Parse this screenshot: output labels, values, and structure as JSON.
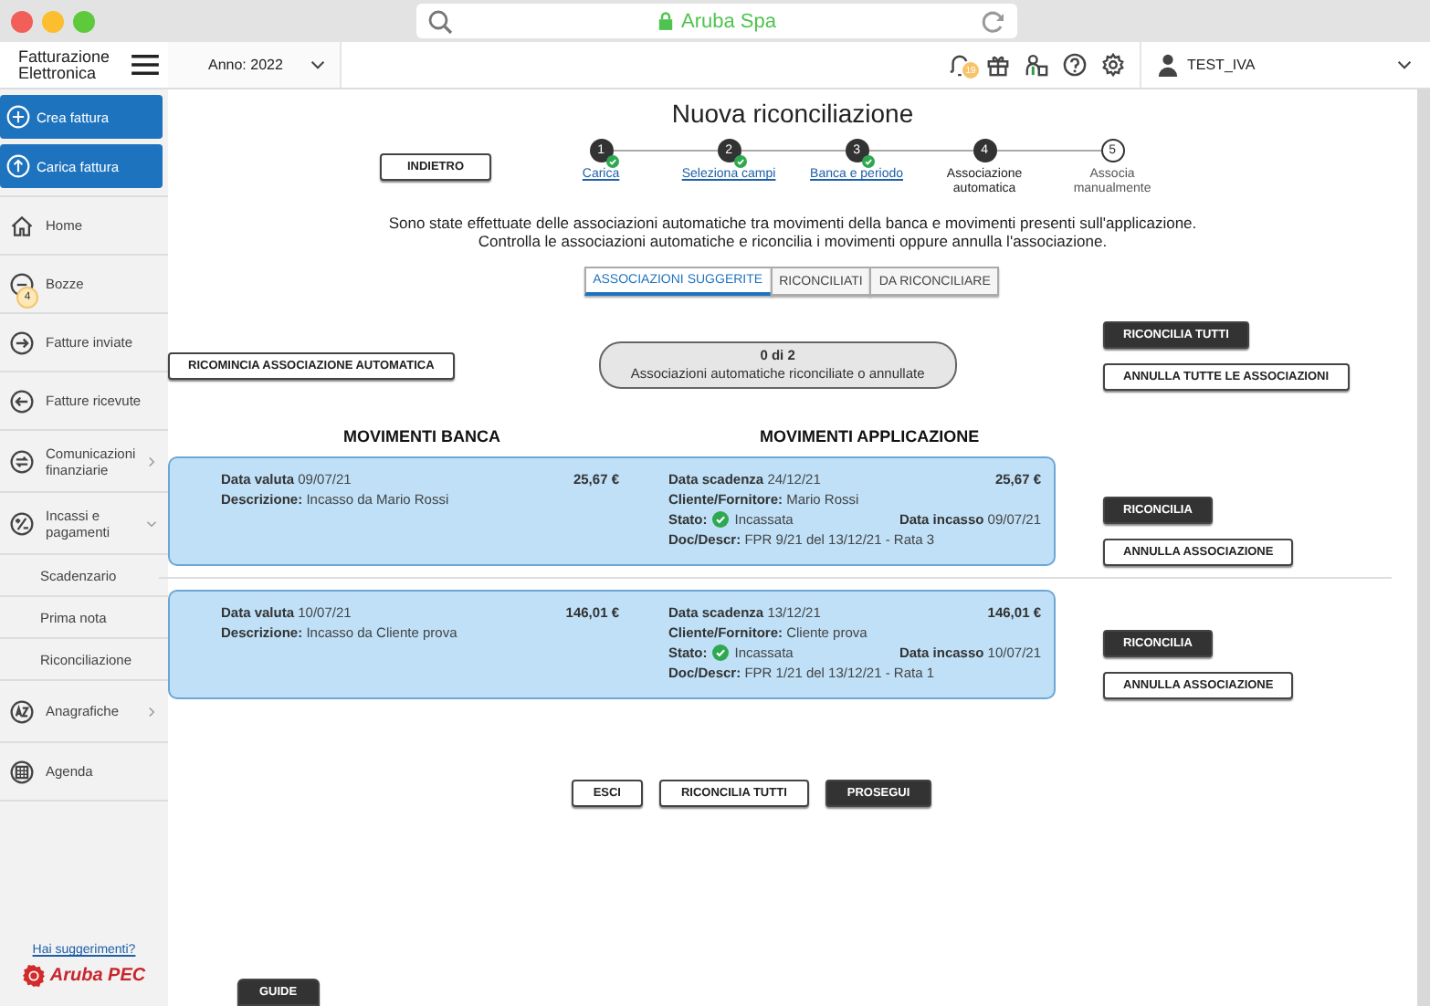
{
  "browser": {
    "address": "Aruba Spa"
  },
  "header": {
    "app_name": "Fatturazione Elettronica",
    "year": "Anno: 2022",
    "notification_count": "19",
    "user": "TEST_IVA"
  },
  "sidebar": {
    "actions": [
      "Crea fattura",
      "Carica fattura"
    ],
    "items": [
      {
        "label": "Home",
        "kind": "link"
      },
      {
        "label": "Bozze",
        "kind": "link",
        "badge": "4"
      },
      {
        "label": "Fatture inviate",
        "kind": "link"
      },
      {
        "label": "Fatture ricevute",
        "kind": "link"
      },
      {
        "label": "Comunicazioni finanziarie",
        "kind": "group",
        "expanded": false
      },
      {
        "label": "Incassi e pagamenti",
        "kind": "group",
        "expanded": true,
        "children": [
          {
            "label": "Scadenzario"
          },
          {
            "label": "Prima nota"
          },
          {
            "label": "Riconciliazione"
          }
        ]
      },
      {
        "label": "Anagrafiche",
        "kind": "group",
        "expanded": false
      },
      {
        "label": "Agenda",
        "kind": "link"
      }
    ],
    "suggestions_link": "Hai suggerimenti?",
    "brand": "Aruba PEC",
    "guide_button": "GUIDE"
  },
  "main": {
    "title": "Nuova riconciliazione",
    "back_button": "INDIETRO",
    "steps": [
      {
        "number": "1",
        "label": "Carica",
        "completed": true,
        "current": false
      },
      {
        "number": "2",
        "label": "Seleziona campi",
        "completed": true,
        "current": false
      },
      {
        "number": "3",
        "label": "Banca e periodo",
        "completed": true,
        "current": false
      },
      {
        "number": "4",
        "label": "Associazione automatica",
        "completed": false,
        "current": true
      },
      {
        "number": "5",
        "label": "Associa manualmente",
        "completed": false,
        "current": false
      }
    ],
    "intro": [
      "Sono state effettuate delle associazioni automatiche tra movimenti della banca e movimenti presenti sull'applicazione.",
      "Controlla le associazioni automatiche e riconcilia i movimenti oppure annulla l'associazione."
    ],
    "tabs": [
      {
        "label": "ASSOCIAZIONI SUGGERITE",
        "selected": true
      },
      {
        "label": "RICONCILIATI",
        "selected": false
      },
      {
        "label": "DA RICONCILIARE",
        "selected": false
      }
    ],
    "restart_button": "RICOMINCIA ASSOCIAZIONE AUTOMATICA",
    "progress": {
      "count": "0 di 2",
      "caption": "Associazioni automatiche riconciliate o annullate"
    },
    "bulk_actions": [
      {
        "label": "RICONCILIA TUTTI",
        "kind": "primary"
      },
      {
        "label": "ANNULLA TUTTE LE ASSOCIAZIONI",
        "kind": "secondary"
      }
    ],
    "column_headings": [
      "MOVIMENTI BANCA",
      "MOVIMENTI APPLICAZIONE"
    ],
    "matches": [
      {
        "bank": {
          "date": "**Data valuta**  09/07/21",
          "amount": "25,67 €",
          "description": "**Descrizione:** Incasso da Mario Rossi"
        },
        "app": {
          "due": "**Data scadenza** 24/12/21",
          "amount": "25,67 €",
          "client": "**Cliente/Fornitore:** Mario Rossi",
          "status_label": "Stato:",
          "status": {
            "label": "Incassata",
            "kind": "collected"
          },
          "collected": "**Data incasso** 09/07/21",
          "document": "**Doc/Descr:** FPR 9/21 del 13/12/21 - Rata 3"
        },
        "actions": [
          {
            "label": "RICONCILIA",
            "kind": "primary"
          },
          {
            "label": "ANNULLA ASSOCIAZIONE",
            "kind": "secondary"
          }
        ]
      },
      {
        "bank": {
          "date": "**Data valuta**  10/07/21",
          "amount": "146,01 €",
          "description": "**Descrizione:** Incasso da Cliente prova"
        },
        "app": {
          "due": "**Data scadenza** 13/12/21",
          "amount": "146,01 €",
          "client": "**Cliente/Fornitore:** Cliente prova",
          "status_label": "Stato:",
          "status": {
            "label": "Incassata",
            "kind": "collected"
          },
          "collected": "**Data incasso** 10/07/21",
          "document": "**Doc/Descr:** FPR 1/21 del 13/12/21 - Rata 1"
        },
        "actions": [
          {
            "label": "RICONCILIA",
            "kind": "primary"
          },
          {
            "label": "ANNULLA ASSOCIAZIONE",
            "kind": "secondary"
          }
        ]
      }
    ],
    "footer_buttons": [
      {
        "label": "ESCI",
        "kind": "secondary"
      },
      {
        "label": "RICONCILIA TUTTI",
        "kind": "secondary"
      },
      {
        "label": "PROSEGUI",
        "kind": "primary"
      }
    ]
  }
}
